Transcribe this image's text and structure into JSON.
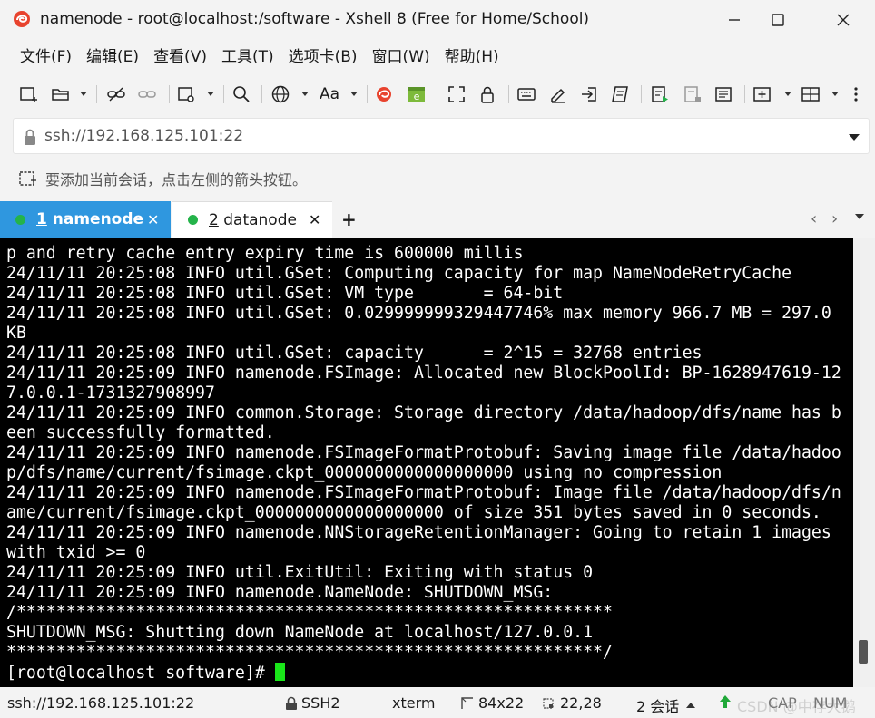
{
  "window": {
    "title": "namenode - root@localhost:/software - Xshell 8 (Free for Home/School)"
  },
  "menu": [
    "文件(F)",
    "编辑(E)",
    "查看(V)",
    "工具(T)",
    "选项卡(B)",
    "窗口(W)",
    "帮助(H)"
  ],
  "address": {
    "value": "ssh://192.168.125.101:22"
  },
  "hint": {
    "text": "要添加当前会话，点击左侧的箭头按钮。"
  },
  "tabs": [
    {
      "number": "1",
      "label": "namenode",
      "active": true
    },
    {
      "number": "2",
      "label": "datanode",
      "active": false
    }
  ],
  "terminal": {
    "lines": [
      "p and retry cache entry expiry time is 600000 millis",
      "24/11/11 20:25:08 INFO util.GSet: Computing capacity for map NameNodeRetryCache",
      "24/11/11 20:25:08 INFO util.GSet: VM type       = 64-bit",
      "24/11/11 20:25:08 INFO util.GSet: 0.029999999329447746% max memory 966.7 MB = 297.0",
      "KB",
      "24/11/11 20:25:08 INFO util.GSet: capacity      = 2^15 = 32768 entries",
      "24/11/11 20:25:09 INFO namenode.FSImage: Allocated new BlockPoolId: BP-1628947619-12",
      "7.0.0.1-1731327908997",
      "24/11/11 20:25:09 INFO common.Storage: Storage directory /data/hadoop/dfs/name has b",
      "een successfully formatted.",
      "24/11/11 20:25:09 INFO namenode.FSImageFormatProtobuf: Saving image file /data/hadoo",
      "p/dfs/name/current/fsimage.ckpt_0000000000000000000 using no compression",
      "24/11/11 20:25:09 INFO namenode.FSImageFormatProtobuf: Image file /data/hadoop/dfs/n",
      "ame/current/fsimage.ckpt_0000000000000000000 of size 351 bytes saved in 0 seconds.",
      "24/11/11 20:25:09 INFO namenode.NNStorageRetentionManager: Going to retain 1 images",
      "with txid >= 0",
      "24/11/11 20:25:09 INFO util.ExitUtil: Exiting with status 0",
      "24/11/11 20:25:09 INFO namenode.NameNode: SHUTDOWN_MSG:",
      "/************************************************************",
      "SHUTDOWN_MSG: Shutting down NameNode at localhost/127.0.0.1",
      "************************************************************/"
    ],
    "prompt": "[root@localhost software]# "
  },
  "status": {
    "connection": "ssh://192.168.125.101:22",
    "protocol": "SSH2",
    "terminal_type": "xterm",
    "size": "84x22",
    "cursor_pos": "22,28",
    "sessions": "2 会话",
    "caps": "CAP",
    "num": "NUM"
  },
  "watermark": "CSDN @中存大鹅",
  "colors": {
    "active_tab": "#2f97df",
    "tab_dot": "#24b34a",
    "cursor": "#19e619"
  }
}
